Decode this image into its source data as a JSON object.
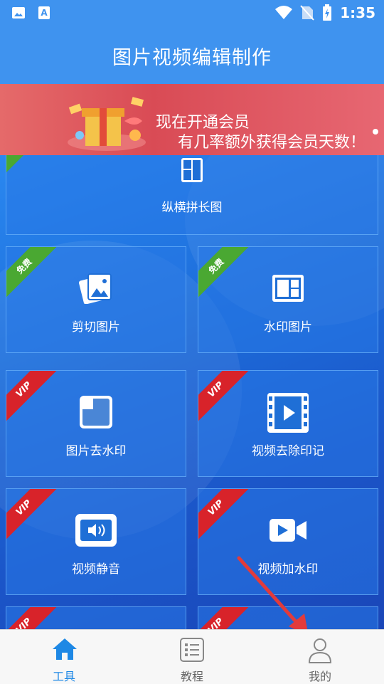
{
  "status_bar": {
    "time": "1:35"
  },
  "header": {
    "title": "图片视频编辑制作"
  },
  "banner": {
    "line1": "现在开通会员",
    "line2": "有几率额外获得会员天数！"
  },
  "tools": [
    {
      "label": "纵横拼长图",
      "badge": ""
    },
    {
      "label": "剪切图片",
      "badge": "免费"
    },
    {
      "label": "水印图片",
      "badge": "免费"
    },
    {
      "label": "图片去水印",
      "badge": "VIP"
    },
    {
      "label": "视频去除印记",
      "badge": "VIP"
    },
    {
      "label": "视频静音",
      "badge": "VIP"
    },
    {
      "label": "视频加水印",
      "badge": "VIP"
    },
    {
      "label": "",
      "badge": "VIP"
    },
    {
      "label": "",
      "badge": "VIP"
    }
  ],
  "tabbar": [
    {
      "label": "工具",
      "icon": "home-icon",
      "active": true
    },
    {
      "label": "教程",
      "icon": "list-icon",
      "active": false
    },
    {
      "label": "我的",
      "icon": "person-icon",
      "active": false
    }
  ],
  "colors": {
    "header": "#3f93ef",
    "active_tab": "#1e88e5",
    "vip": "#d8232a",
    "free": "#4aa832"
  }
}
